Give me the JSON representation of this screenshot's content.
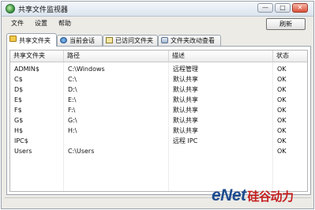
{
  "window": {
    "title": "共享文件监视器"
  },
  "title_buttons": {
    "minimize": "—",
    "maximize": "□",
    "close": "✕"
  },
  "menu": [
    {
      "label": "文件"
    },
    {
      "label": "设置"
    },
    {
      "label": "帮助"
    }
  ],
  "toolbar": {
    "refresh_label": "刷新"
  },
  "tabs": [
    {
      "label": "共享文件夹",
      "icon": "shared-folder-icon",
      "active": true
    },
    {
      "label": "当前会话",
      "icon": "sessions-icon",
      "active": false
    },
    {
      "label": "已访问文件夹",
      "icon": "accessed-folder-icon",
      "active": false
    },
    {
      "label": "文件夹改动查看",
      "icon": "folder-changes-icon",
      "active": false
    }
  ],
  "table": {
    "columns": [
      "共享文件夹",
      "路径",
      "描述",
      "状态"
    ],
    "rows": [
      {
        "name": "ADMIN$",
        "path": "C:\\Windows",
        "desc": "远程管理",
        "status": "OK"
      },
      {
        "name": "C$",
        "path": "C:\\",
        "desc": "默认共享",
        "status": "OK"
      },
      {
        "name": "D$",
        "path": "D:\\",
        "desc": "默认共享",
        "status": "OK"
      },
      {
        "name": "E$",
        "path": "E:\\",
        "desc": "默认共享",
        "status": "OK"
      },
      {
        "name": "F$",
        "path": "F:\\",
        "desc": "默认共享",
        "status": "OK"
      },
      {
        "name": "G$",
        "path": "G:\\",
        "desc": "默认共享",
        "status": "OK"
      },
      {
        "name": "H$",
        "path": "H:\\",
        "desc": "默认共享",
        "status": "OK"
      },
      {
        "name": "IPC$",
        "path": "",
        "desc": "远程 IPC",
        "status": "OK"
      },
      {
        "name": "Users",
        "path": "C:\\Users",
        "desc": "",
        "status": "OK"
      }
    ]
  },
  "watermark": {
    "brand": "eNet",
    "sub": "硅谷动力"
  }
}
